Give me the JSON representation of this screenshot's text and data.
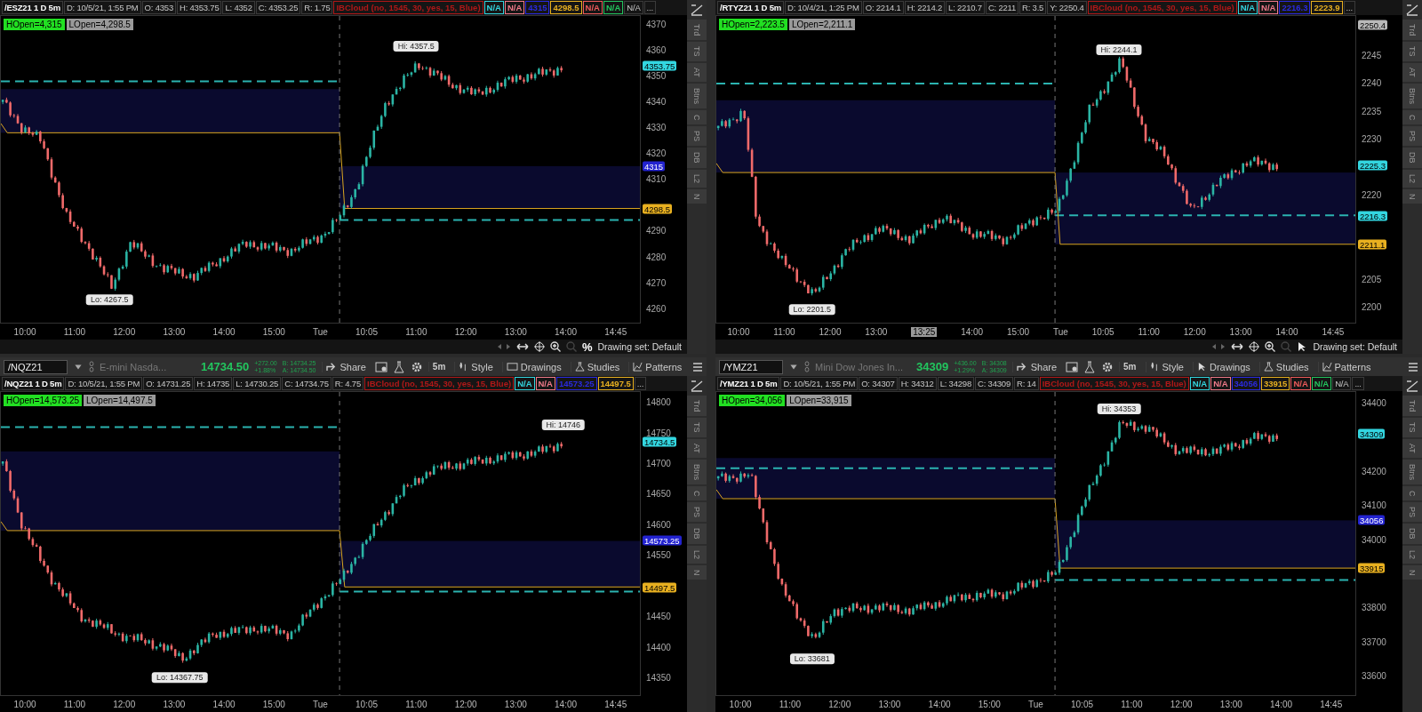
{
  "panels": [
    {
      "header": {
        "title": "/ESZ21 1 D 5m",
        "cells": [
          {
            "text": "D: 10/5/21, 1:55 PM"
          },
          {
            "text": "O: 4353"
          },
          {
            "text": "H: 4353.75"
          },
          {
            "text": "L: 4352"
          },
          {
            "text": "C: 4353.25"
          },
          {
            "text": "R: 1.75"
          },
          {
            "text": "IBCloud (no, 1545, 30, yes, 15, Blue)",
            "color": "#b01818"
          },
          {
            "text": "N/A",
            "color": "#33d6e0"
          },
          {
            "text": "N/A",
            "color": "#f07a8a"
          },
          {
            "text": "4315",
            "color": "#2a2ae0"
          },
          {
            "text": "4298.5",
            "color": "#e8b020"
          },
          {
            "text": "N/A",
            "color": "#f05b5b"
          },
          {
            "text": "N/A",
            "color": "#22c55e"
          },
          {
            "text": "N/A"
          },
          {
            "text": "..."
          }
        ]
      },
      "badges": [
        {
          "text": "HOpen=4,315",
          "kind": "high"
        },
        {
          "text": "LOpen=4,298.5",
          "kind": "low"
        }
      ],
      "price_axis": {
        "ticks": [
          "4370",
          "4360",
          "4350",
          "4340",
          "4330",
          "4320",
          "4310",
          "4290",
          "4280",
          "4270",
          "4260"
        ],
        "markers": [
          {
            "text": "4353.75",
            "color": "#33d6e0"
          },
          {
            "text": "4315",
            "color": "#2323d0"
          },
          {
            "text": "4298.5",
            "color": "#e8b020"
          }
        ]
      },
      "hi_label": "Hi: 4357.5",
      "lo_label": "Lo: 4267.5",
      "side_tabs": [
        "Trd",
        "TS",
        "AT",
        "Btns",
        "C",
        "PS",
        "DB",
        "L2",
        "N"
      ],
      "time_axis": [
        {
          "text": "10:00",
          "kind": "tick"
        },
        {
          "text": "11:00",
          "kind": "tick"
        },
        {
          "text": "12:00",
          "kind": "tick"
        },
        {
          "text": "13:00",
          "kind": "tick"
        },
        {
          "text": "14:00",
          "kind": "tick"
        },
        {
          "text": "15:00",
          "kind": "tick"
        },
        {
          "text": "Tue",
          "kind": "tick"
        },
        {
          "text": "10:05",
          "kind": "tick"
        },
        {
          "text": "11:00",
          "kind": "tick"
        },
        {
          "text": "12:00",
          "kind": "tick"
        },
        {
          "text": "13:00",
          "kind": "tick"
        },
        {
          "text": "14:00",
          "kind": "tick"
        },
        {
          "text": "14:45",
          "kind": "tick"
        }
      ],
      "scroll_bar": {
        "tool_glyph": "%",
        "drawing_set": "Drawing set: Default"
      }
    },
    {
      "header": {
        "title": "/RTYZ21 1 D 5m",
        "cells": [
          {
            "text": "D: 10/4/21, 1:25 PM"
          },
          {
            "text": "O: 2214.1"
          },
          {
            "text": "H: 2214.2"
          },
          {
            "text": "L: 2210.7"
          },
          {
            "text": "C: 2211"
          },
          {
            "text": "R: 3.5"
          },
          {
            "text": "Y: 2250.4"
          },
          {
            "text": "IBCloud (no, 1545, 30, yes, 15, Blue)",
            "color": "#b01818"
          },
          {
            "text": "N/A",
            "color": "#33d6e0"
          },
          {
            "text": "N/A",
            "color": "#f07a8a"
          },
          {
            "text": "2216.3",
            "color": "#2a2ae0"
          },
          {
            "text": "2223.9",
            "color": "#e8b020"
          },
          {
            "text": "..."
          }
        ]
      },
      "badges": [
        {
          "text": "HOpen=2,223.5",
          "kind": "high"
        },
        {
          "text": "LOpen=2,211.1",
          "kind": "low"
        }
      ],
      "price_axis": {
        "ticks": [
          "2245",
          "2240",
          "2235",
          "2230",
          "2220",
          "2205",
          "2200"
        ],
        "markers": [
          {
            "text": "2250.4",
            "color": "#b8b8b8"
          },
          {
            "text": "2225.3",
            "color": "#33d6e0"
          },
          {
            "text": "2216.3",
            "color": "#33d6e0"
          },
          {
            "text": "2211.1",
            "color": "#e8b020"
          }
        ]
      },
      "hi_label": "Hi: 2244.1",
      "lo_label": "Lo: 2201.5",
      "side_tabs": [
        "Trd",
        "TS",
        "AT",
        "Btns",
        "C",
        "PS",
        "DB",
        "L2",
        "N"
      ],
      "time_axis": [
        {
          "text": "10:00",
          "kind": "tick"
        },
        {
          "text": "11:00",
          "kind": "tick"
        },
        {
          "text": "12:00",
          "kind": "tick"
        },
        {
          "text": "13:00",
          "kind": "tick"
        },
        {
          "text": "13:25",
          "kind": "cursor"
        },
        {
          "text": "14:00",
          "kind": "tick"
        },
        {
          "text": "15:00",
          "kind": "tick"
        },
        {
          "text": "Tue",
          "kind": "tick"
        },
        {
          "text": "10:05",
          "kind": "tick"
        },
        {
          "text": "11:00",
          "kind": "tick"
        },
        {
          "text": "12:00",
          "kind": "tick"
        },
        {
          "text": "13:00",
          "kind": "tick"
        },
        {
          "text": "14:00",
          "kind": "tick"
        },
        {
          "text": "14:45",
          "kind": "tick"
        }
      ],
      "scroll_bar": {
        "drawing_set": "Drawing set: Default"
      }
    },
    {
      "toolbar": {
        "symbol": "/NQZ21",
        "description": "E-mini Nasda...",
        "last": "14734.50",
        "change": "+272.00",
        "change_pct": "+1.88%",
        "bid": "B: 14734.25",
        "ask": "A: 14734.50",
        "tools": [
          "Share",
          "5m",
          "Style",
          "Drawings",
          "Studies",
          "Patterns"
        ]
      },
      "header": {
        "title": "/NQZ21 1 D 5m",
        "cells": [
          {
            "text": "D: 10/5/21, 1:55 PM"
          },
          {
            "text": "O: 14731.25"
          },
          {
            "text": "H: 14735"
          },
          {
            "text": "L: 14730.25"
          },
          {
            "text": "C: 14734.75"
          },
          {
            "text": "R: 4.75"
          },
          {
            "text": "IBCloud (no, 1545, 30, yes, 15, Blue)",
            "color": "#b01818"
          },
          {
            "text": "N/A",
            "color": "#33d6e0"
          },
          {
            "text": "N/A",
            "color": "#f07a8a"
          },
          {
            "text": "14573.25",
            "color": "#2a2ae0"
          },
          {
            "text": "14497.5",
            "color": "#e8b020"
          },
          {
            "text": "..."
          }
        ]
      },
      "badges": [
        {
          "text": "HOpen=14,573.25",
          "kind": "high"
        },
        {
          "text": "LOpen=14,497.5",
          "kind": "low"
        }
      ],
      "price_axis": {
        "ticks": [
          "14800",
          "14750",
          "14700",
          "14650",
          "14600",
          "14550",
          "14450",
          "14400",
          "14350"
        ],
        "markers": [
          {
            "text": "14734.5",
            "color": "#33d6e0"
          },
          {
            "text": "14573.25",
            "color": "#2323d0"
          },
          {
            "text": "14497.5",
            "color": "#e8b020"
          }
        ]
      },
      "hi_label": "Hi: 14746",
      "lo_label": "Lo: 14367.75",
      "side_tabs": [
        "Trd",
        "TS",
        "AT",
        "Btns",
        "C",
        "PS",
        "DB",
        "L2",
        "N"
      ],
      "time_axis": [
        {
          "text": "10:00",
          "kind": "tick"
        },
        {
          "text": "11:00",
          "kind": "tick"
        },
        {
          "text": "12:00",
          "kind": "tick"
        },
        {
          "text": "13:00",
          "kind": "tick"
        },
        {
          "text": "14:00",
          "kind": "tick"
        },
        {
          "text": "15:00",
          "kind": "tick"
        },
        {
          "text": "Tue",
          "kind": "tick"
        },
        {
          "text": "10:05",
          "kind": "tick"
        },
        {
          "text": "11:00",
          "kind": "tick"
        },
        {
          "text": "12:00",
          "kind": "tick"
        },
        {
          "text": "13:00",
          "kind": "tick"
        },
        {
          "text": "14:00",
          "kind": "tick"
        },
        {
          "text": "14:45",
          "kind": "tick"
        }
      ]
    },
    {
      "toolbar": {
        "symbol": "/YMZ21",
        "description": "Mini Dow Jones In...",
        "last": "34309",
        "change": "+436.00",
        "change_pct": "+1.29%",
        "bid": "B: 34308",
        "ask": "A: 34309",
        "tools": [
          "Share",
          "5m",
          "Style",
          "Drawings",
          "Studies",
          "Patterns"
        ]
      },
      "header": {
        "title": "/YMZ21 1 D 5m",
        "cells": [
          {
            "text": "D: 10/5/21, 1:55 PM"
          },
          {
            "text": "O: 34307"
          },
          {
            "text": "H: 34312"
          },
          {
            "text": "L: 34298"
          },
          {
            "text": "C: 34309"
          },
          {
            "text": "R: 14"
          },
          {
            "text": "IBCloud (no, 1545, 30, yes, 15, Blue)",
            "color": "#b01818"
          },
          {
            "text": "N/A",
            "color": "#33d6e0"
          },
          {
            "text": "N/A",
            "color": "#f07a8a"
          },
          {
            "text": "34056",
            "color": "#2a2ae0"
          },
          {
            "text": "33915",
            "color": "#e8b020"
          },
          {
            "text": "N/A",
            "color": "#f05b5b"
          },
          {
            "text": "N/A",
            "color": "#22c55e"
          },
          {
            "text": "N/A"
          },
          {
            "text": "..."
          }
        ]
      },
      "badges": [
        {
          "text": "HOpen=34,056",
          "kind": "high"
        },
        {
          "text": "LOpen=33,915",
          "kind": "low"
        }
      ],
      "price_axis": {
        "ticks": [
          "34400",
          "34200",
          "34100",
          "34000",
          "33800",
          "33700",
          "33600"
        ],
        "markers": [
          {
            "text": "34309",
            "color": "#33d6e0"
          },
          {
            "text": "34056",
            "color": "#2323d0"
          },
          {
            "text": "33915",
            "color": "#e8b020"
          }
        ]
      },
      "hi_label": "Hi: 34353",
      "lo_label": "Lo: 33681",
      "side_tabs": [
        "Trd",
        "TS",
        "AT",
        "Btns",
        "C",
        "PS",
        "DB",
        "L2",
        "N"
      ],
      "time_axis": [
        {
          "text": "10:00",
          "kind": "tick"
        },
        {
          "text": "11:00",
          "kind": "tick"
        },
        {
          "text": "12:00",
          "kind": "tick"
        },
        {
          "text": "13:00",
          "kind": "tick"
        },
        {
          "text": "14:00",
          "kind": "tick"
        },
        {
          "text": "15:00",
          "kind": "tick"
        },
        {
          "text": "Tue",
          "kind": "tick"
        },
        {
          "text": "10:05",
          "kind": "tick"
        },
        {
          "text": "11:00",
          "kind": "tick"
        },
        {
          "text": "12:00",
          "kind": "tick"
        },
        {
          "text": "13:00",
          "kind": "tick"
        },
        {
          "text": "14:00",
          "kind": "tick"
        },
        {
          "text": "14:45",
          "kind": "tick"
        }
      ]
    }
  ]
}
